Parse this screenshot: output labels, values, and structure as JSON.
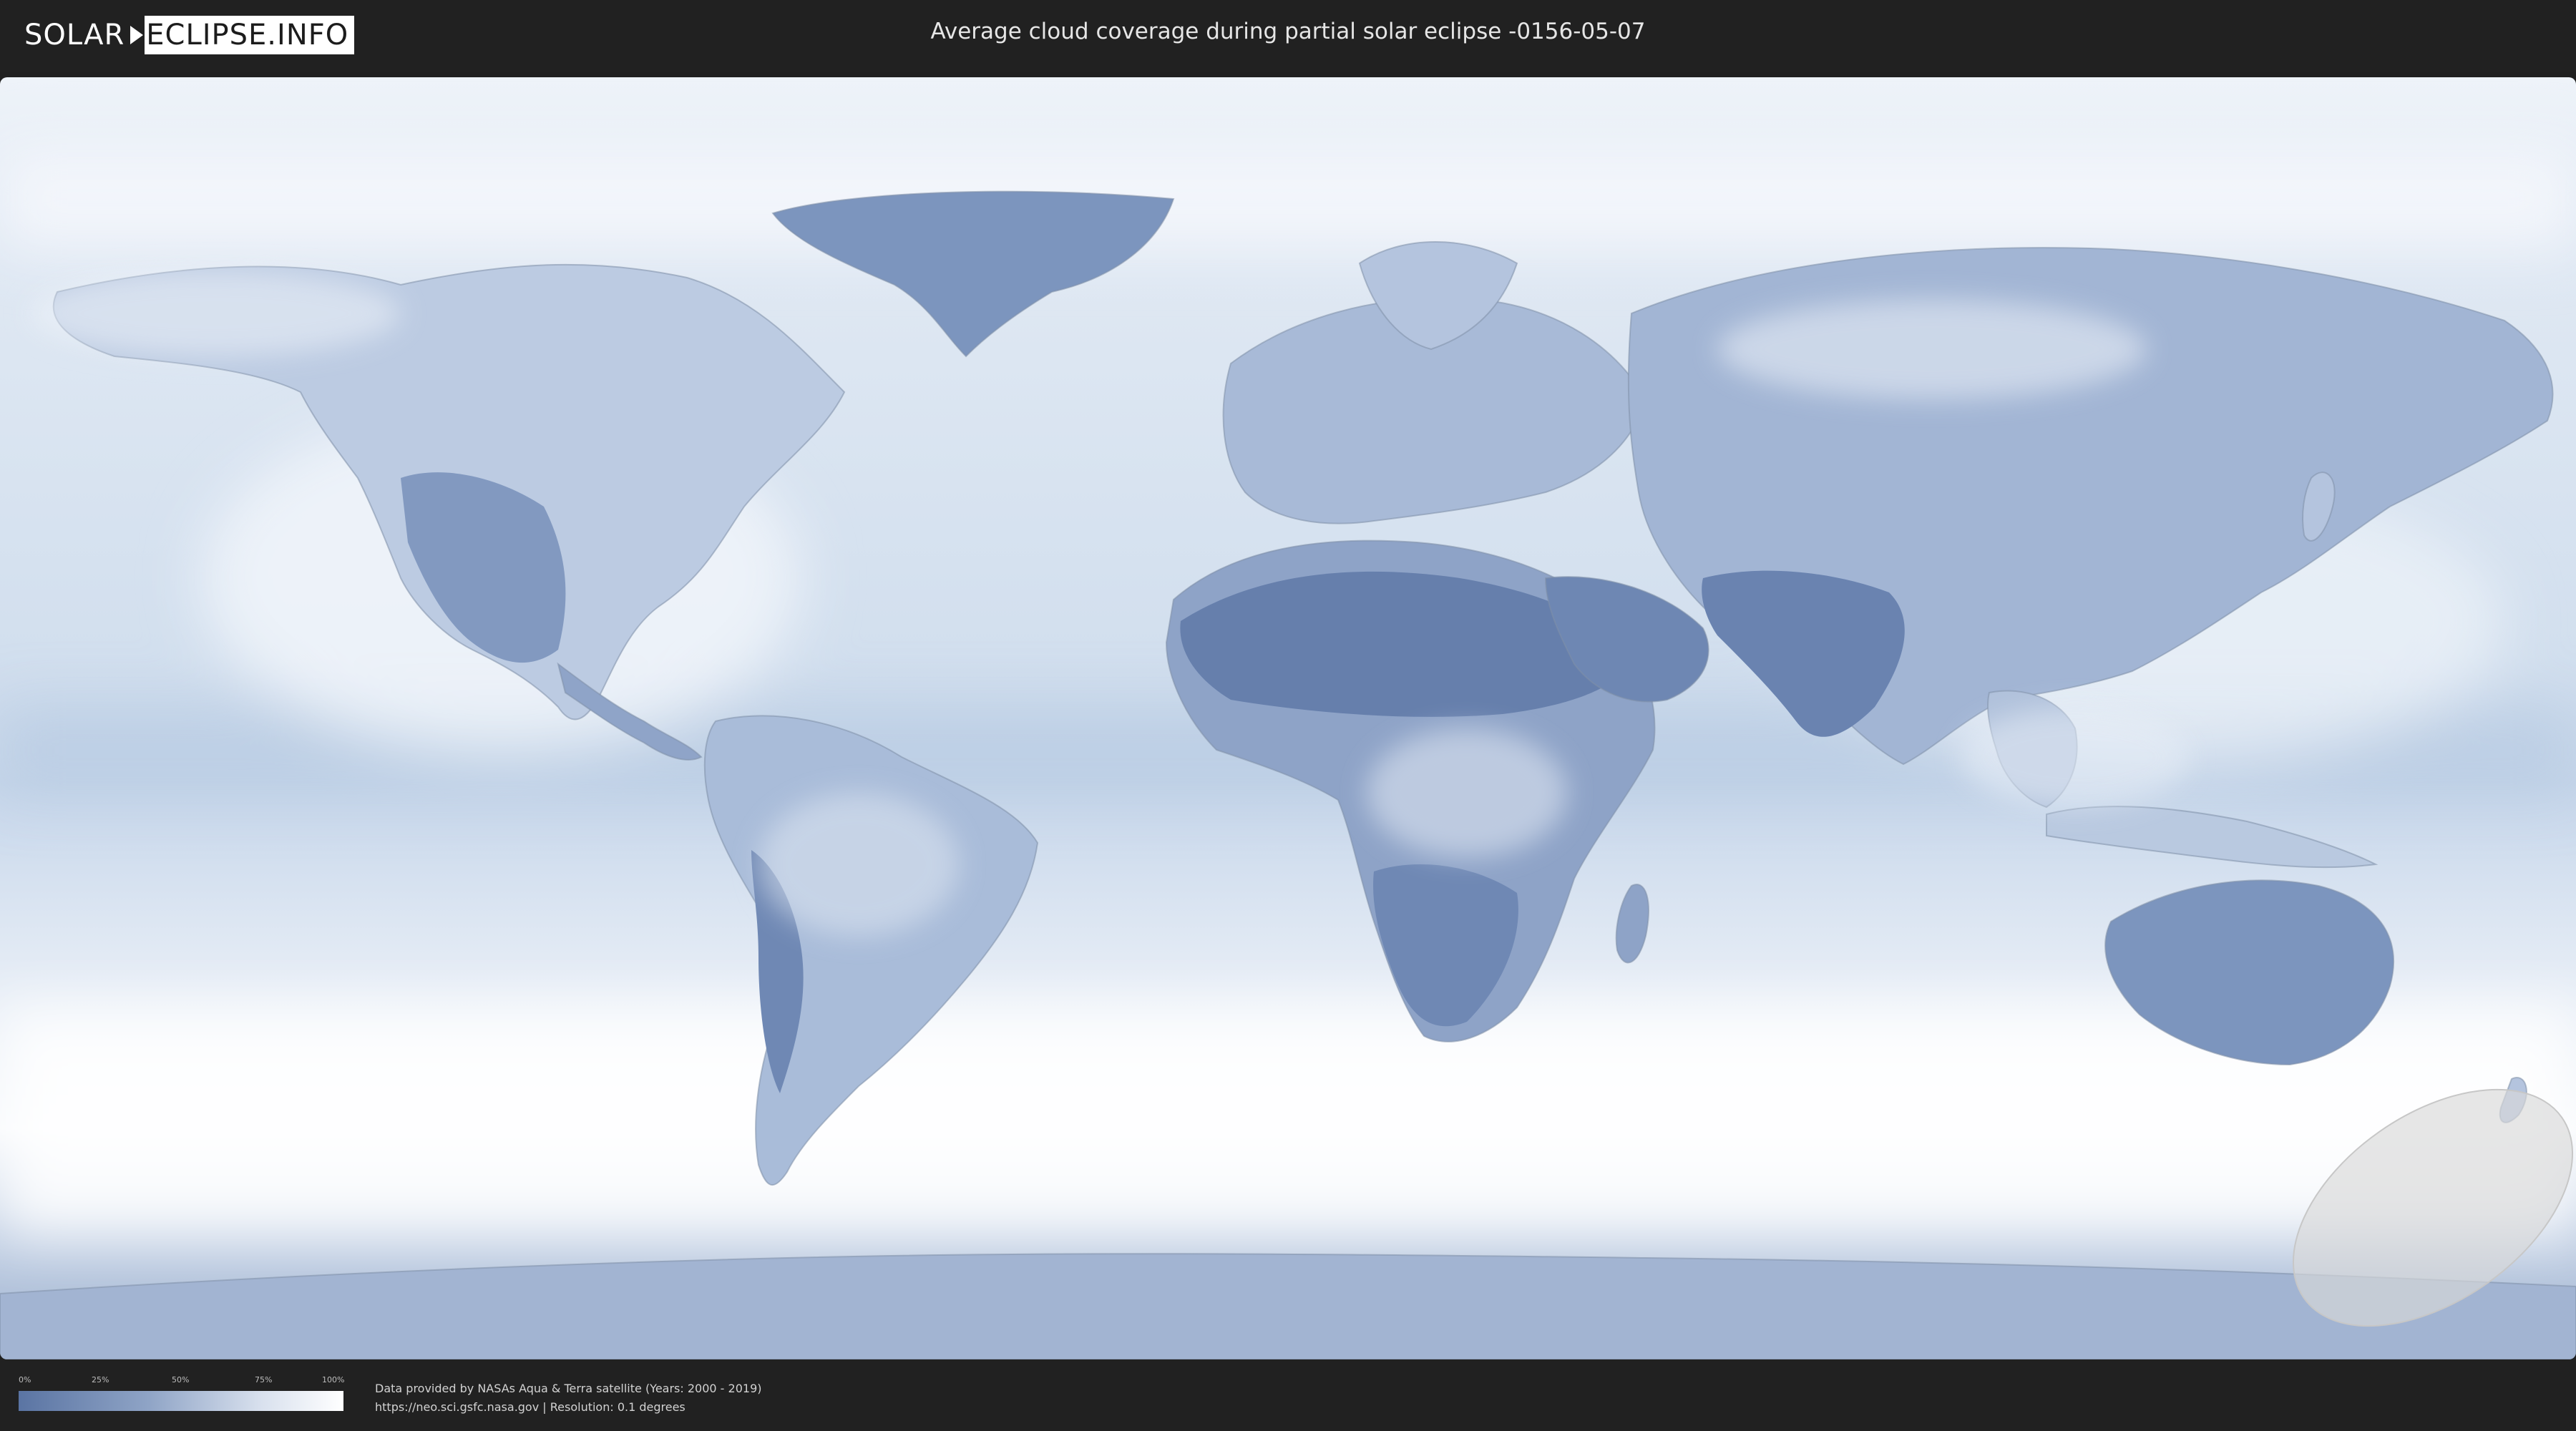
{
  "header": {
    "logo_part1": "SOLAR",
    "logo_part2": "ECLIPSE.INFO",
    "title": "Average cloud coverage during partial solar eclipse -0156-05-07"
  },
  "legend": {
    "ticks": [
      "0%",
      "25%",
      "50%",
      "75%",
      "100%"
    ],
    "colors": {
      "low": "#5a74a3",
      "mid": "#8fa4c6",
      "high": "#ffffff"
    }
  },
  "footer": {
    "credit_line1": "Data provided by NASAs Aqua & Terra satellite (Years: 2000 - 2019)",
    "credit_line2": "https://neo.sci.gsfc.nasa.gov | Resolution: 0.1 degrees"
  },
  "map": {
    "projection": "equirectangular",
    "layer": "average cloud coverage",
    "eclipse_visibility_area": "south-east Pacific / near Antarctica",
    "colors": {
      "ocean": "#e3ebf5",
      "clear_land": "#6f88b4",
      "cloudy": "#f4f7fb",
      "eclipse_zone": "#d9d9d9"
    }
  }
}
